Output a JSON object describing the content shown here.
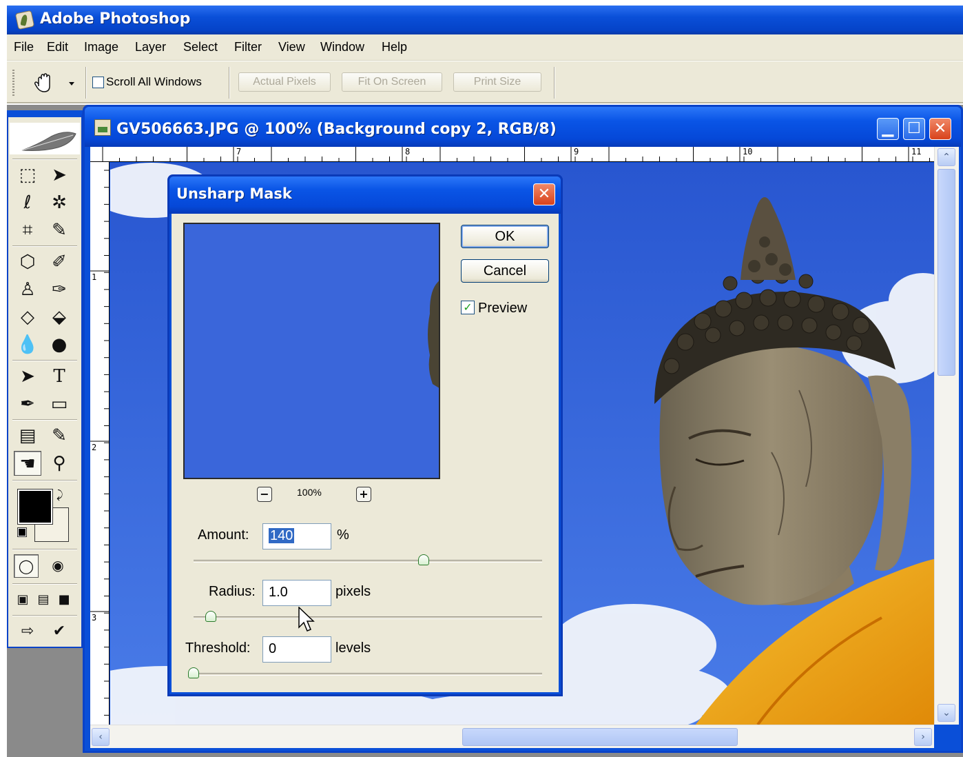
{
  "app": {
    "title": "Adobe Photoshop"
  },
  "menu": [
    "File",
    "Edit",
    "Image",
    "Layer",
    "Select",
    "Filter",
    "View",
    "Window",
    "Help"
  ],
  "options_bar": {
    "scroll_all_label": "Scroll All Windows",
    "scroll_all_checked": false,
    "buttons": [
      "Actual Pixels",
      "Fit On Screen",
      "Print Size"
    ]
  },
  "document": {
    "title": "GV506663.JPG @ 100% (Background copy 2, RGB/8)",
    "ruler_top": [
      "7",
      "8",
      "9",
      "10",
      "11"
    ],
    "ruler_left": [
      "1",
      "2",
      "3"
    ]
  },
  "dialog": {
    "title": "Unsharp Mask",
    "ok_label": "OK",
    "cancel_label": "Cancel",
    "preview_label": "Preview",
    "preview_checked": true,
    "zoom_level": "100%",
    "amount": {
      "label": "Amount:",
      "value": "140",
      "unit": "%",
      "slider_fraction": 0.66
    },
    "radius": {
      "label": "Radius:",
      "value": "1.0",
      "unit": "pixels",
      "slider_fraction": 0.05
    },
    "threshold": {
      "label": "Threshold:",
      "value": "0",
      "unit": "levels",
      "slider_fraction": 0.0
    }
  },
  "colors": {
    "xp_blue": "#0a4fd8",
    "dialog_bg": "#ece9d8",
    "sky": "#3a6ae0",
    "robe": "#f0a814"
  }
}
